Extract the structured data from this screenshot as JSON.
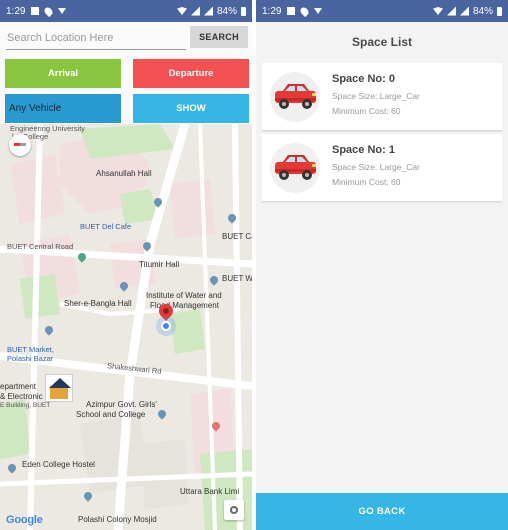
{
  "left_screen": {
    "status": {
      "time": "1:29",
      "battery": "84%"
    },
    "search": {
      "placeholder": "Search Location Here",
      "button": "SEARCH"
    },
    "buttons": {
      "arrival": "Arrival",
      "departure": "Departure",
      "vehicle": "Any Vehicle",
      "show": "SHOW"
    },
    "map_labels": {
      "engineering_university": "Engineering University",
      "school_college": "l & College",
      "ahsanullah": "Ahsanullah Hall",
      "buet_del_cafe": "BUET Del Cafe",
      "buet_ca": "BUET Ca",
      "buet_central": "BUET Central Road",
      "titumir": "Titumir Hall",
      "buet_w": "BUET W",
      "sher_e_bangla": "Sher-e-Bangla Hall",
      "institute_water": "Institute of Water and",
      "flood_mgmt": "Flood Management",
      "buet_market": "BUET Market,",
      "polashi_bazar": "Polashi Bazar",
      "shakeshwari": "Shakeshwari Rd",
      "department": "epartment",
      "electronic": "& Electronic",
      "e_building": "E Building, BUET",
      "azimpur1": "Azimpur Govt. Girls'",
      "azimpur2": "School and College",
      "eden": "Eden College Hostel",
      "uttara_bank": "Uttara Bank Limi",
      "polashi_mosjid": "Polashi Colony Mosjid",
      "google": "Google"
    }
  },
  "right_screen": {
    "status": {
      "time": "1:29",
      "battery": "84%"
    },
    "title": "Space List",
    "spaces": [
      {
        "space_no": "Space No: 0",
        "size": "Space Size: Large_Car",
        "cost": "Minimum Cost: 60"
      },
      {
        "space_no": "Space No: 1",
        "size": "Space Size: Large_Car",
        "cost": "Minimum Cost: 60"
      }
    ],
    "go_back": "GO BACK"
  },
  "colors": {
    "status_bar": "#4a64a0",
    "arrival": "#8bc53f",
    "departure": "#f15153",
    "vehicle": "#2a9bd0",
    "show": "#35b6e4",
    "go_back": "#35b6e4"
  },
  "icons": [
    "gallery-icon",
    "location-icon",
    "download-icon",
    "wifi-icon",
    "signal-icon",
    "battery-icon",
    "compass-icon",
    "map-pin-icon",
    "my-location-icon",
    "garage-icon",
    "car-icon"
  ]
}
